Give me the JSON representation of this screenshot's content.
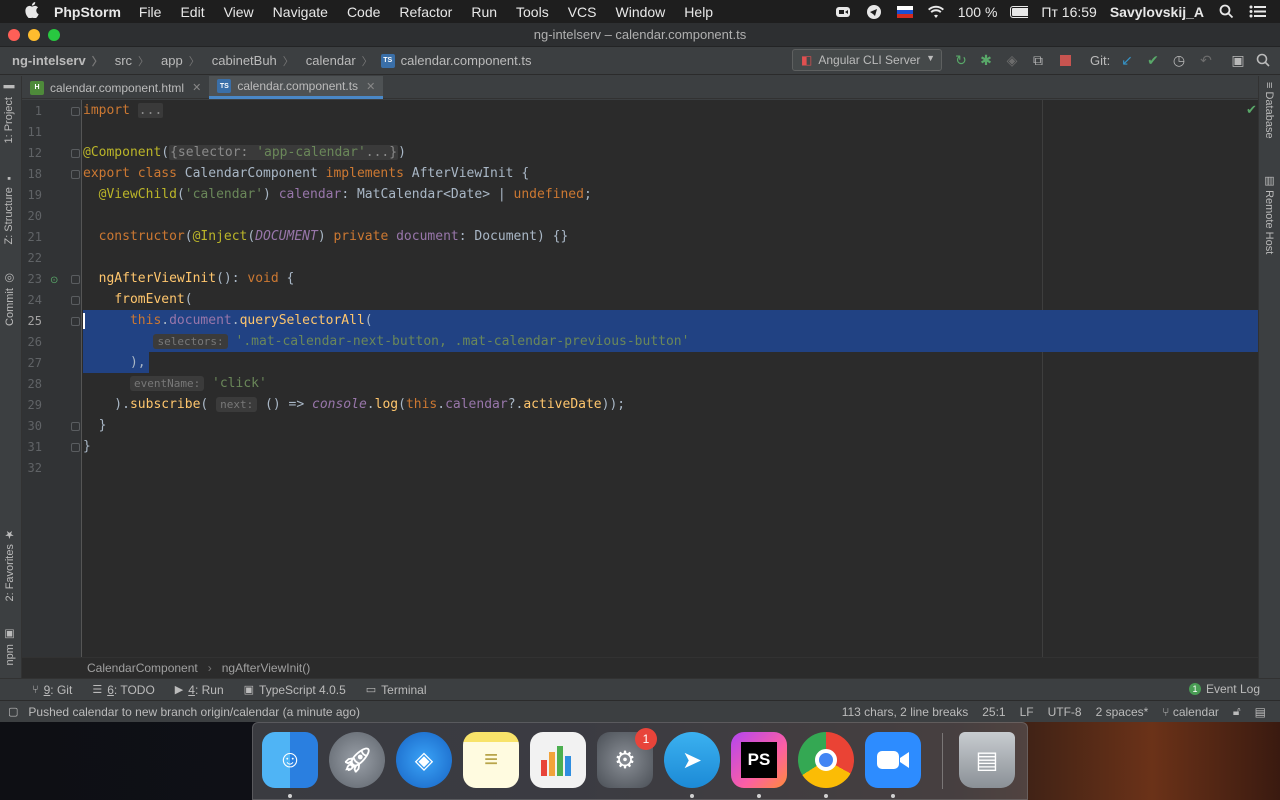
{
  "menubar": {
    "app_name": "PhpStorm",
    "items": [
      "File",
      "Edit",
      "View",
      "Navigate",
      "Code",
      "Refactor",
      "Run",
      "Tools",
      "VCS",
      "Window",
      "Help"
    ],
    "battery": "100 %",
    "clock": "Пт 16:59",
    "user": "Savylovskij_A"
  },
  "window": {
    "title": "ng-intelserv – calendar.component.ts"
  },
  "navbar": {
    "crumbs": [
      "ng-intelserv",
      "src",
      "app",
      "cabinetBuh",
      "calendar",
      "calendar.component.ts"
    ],
    "run_config": "Angular CLI Server",
    "git_label": "Git:"
  },
  "tabs": [
    {
      "label": "calendar.component.html",
      "icon": "html-file-icon"
    },
    {
      "label": "calendar.component.ts",
      "icon": "ts-file-icon"
    }
  ],
  "left_tools": [
    "1: Project",
    "Z: Structure",
    "Commit",
    "2: Favorites",
    "npm"
  ],
  "right_tools": [
    "Database",
    "Remote Host"
  ],
  "editor": {
    "line_numbers": [
      "1",
      "11",
      "12",
      "18",
      "19",
      "20",
      "21",
      "22",
      "23",
      "24",
      "25",
      "26",
      "27",
      "28",
      "29",
      "30",
      "31",
      "32"
    ],
    "hints": {
      "selectors": "selectors:",
      "eventName": "eventName:",
      "next": "next:"
    }
  },
  "code_breadcrumb": [
    "CalendarComponent",
    "ngAfterViewInit()"
  ],
  "bottom_tools": [
    {
      "prefix": "9",
      "label": ": Git"
    },
    {
      "prefix": "6",
      "label": ": TODO"
    },
    {
      "prefix": "4",
      "label": ": Run"
    },
    {
      "prefix": "",
      "label": "TypeScript 4.0.5"
    },
    {
      "prefix": "",
      "label": "Terminal"
    }
  ],
  "event_log": {
    "count": "1",
    "label": "Event Log"
  },
  "status": {
    "message": "Pushed calendar to new branch origin/calendar (a minute ago)",
    "selection": "113 chars, 2 line breaks",
    "position": "25:1",
    "line_sep": "LF",
    "encoding": "UTF-8",
    "indent": "2 spaces*",
    "branch": "calendar"
  },
  "dock": {
    "apps": [
      "finder",
      "launchpad",
      "safari",
      "notes",
      "numbers",
      "system-preferences",
      "telegram",
      "phpstorm",
      "chrome",
      "zoom",
      "trash"
    ],
    "prefs_badge": "1",
    "phpstorm_label": "PS"
  }
}
